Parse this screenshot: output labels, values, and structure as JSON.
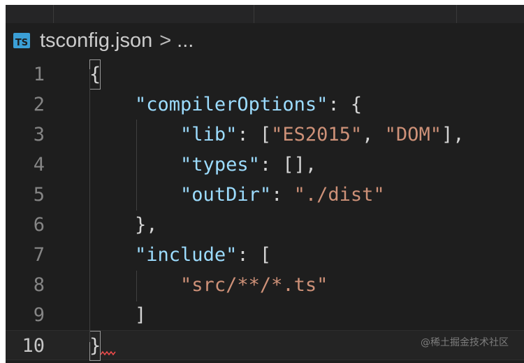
{
  "breadcrumb": {
    "icon_label": "TS",
    "file": "tsconfig.json",
    "separator": ">",
    "more": "..."
  },
  "editor": {
    "active_line": 10,
    "lines": [
      {
        "number": "1",
        "tokens": [
          {
            "t": "punc",
            "v": "{",
            "box": true
          }
        ]
      },
      {
        "number": "2",
        "tokens": [
          {
            "t": "punc",
            "v": "    "
          },
          {
            "t": "key",
            "v": "\"compilerOptions\""
          },
          {
            "t": "punc",
            "v": ": {"
          }
        ]
      },
      {
        "number": "3",
        "tokens": [
          {
            "t": "punc",
            "v": "        "
          },
          {
            "t": "key",
            "v": "\"lib\""
          },
          {
            "t": "punc",
            "v": ": ["
          },
          {
            "t": "str",
            "v": "\"ES2015\""
          },
          {
            "t": "punc",
            "v": ", "
          },
          {
            "t": "str",
            "v": "\"DOM\""
          },
          {
            "t": "punc",
            "v": "],"
          }
        ]
      },
      {
        "number": "4",
        "tokens": [
          {
            "t": "punc",
            "v": "        "
          },
          {
            "t": "key",
            "v": "\"types\""
          },
          {
            "t": "punc",
            "v": ": [],"
          }
        ]
      },
      {
        "number": "5",
        "tokens": [
          {
            "t": "punc",
            "v": "        "
          },
          {
            "t": "key",
            "v": "\"outDir\""
          },
          {
            "t": "punc",
            "v": ": "
          },
          {
            "t": "str",
            "v": "\"./dist\""
          }
        ]
      },
      {
        "number": "6",
        "tokens": [
          {
            "t": "punc",
            "v": "    },"
          }
        ]
      },
      {
        "number": "7",
        "tokens": [
          {
            "t": "punc",
            "v": "    "
          },
          {
            "t": "key",
            "v": "\"include\""
          },
          {
            "t": "punc",
            "v": ": ["
          }
        ]
      },
      {
        "number": "8",
        "tokens": [
          {
            "t": "punc",
            "v": "        "
          },
          {
            "t": "str",
            "v": "\"src/**/*.ts\""
          }
        ]
      },
      {
        "number": "9",
        "tokens": [
          {
            "t": "punc",
            "v": "    ]"
          }
        ]
      },
      {
        "number": "10",
        "tokens": [
          {
            "t": "punc",
            "v": "}",
            "box": true
          }
        ]
      }
    ]
  },
  "watermark": "@稀土掘金技术社区",
  "colors": {
    "background": "#1e1e1e",
    "key": "#9cdcfe",
    "string": "#ce9178",
    "punctuation": "#d4d4d4",
    "line_number": "#858585",
    "ts_icon": "#3b9fd6",
    "error_squiggle": "#f14c4c"
  }
}
